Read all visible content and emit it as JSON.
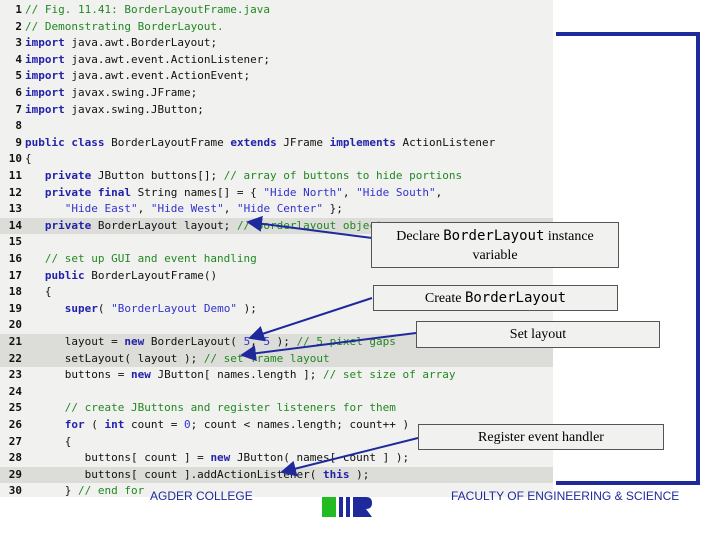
{
  "code_lines": [
    {
      "num": "1",
      "parts": [
        [
          "c",
          "// Fig. 11.41: BorderLayoutFrame.java"
        ]
      ]
    },
    {
      "num": "2",
      "parts": [
        [
          "c",
          "// Demonstrating BorderLayout."
        ]
      ]
    },
    {
      "num": "3",
      "parts": [
        [
          "k",
          "import"
        ],
        [
          "t",
          " java.awt.BorderLayout;"
        ]
      ]
    },
    {
      "num": "4",
      "parts": [
        [
          "k",
          "import"
        ],
        [
          "t",
          " java.awt.event.ActionListener;"
        ]
      ]
    },
    {
      "num": "5",
      "parts": [
        [
          "k",
          "import"
        ],
        [
          "t",
          " java.awt.event.ActionEvent;"
        ]
      ]
    },
    {
      "num": "6",
      "parts": [
        [
          "k",
          "import"
        ],
        [
          "t",
          " javax.swing.JFrame;"
        ]
      ]
    },
    {
      "num": "7",
      "parts": [
        [
          "k",
          "import"
        ],
        [
          "t",
          " javax.swing.JButton;"
        ]
      ]
    },
    {
      "num": "8",
      "parts": []
    },
    {
      "num": "9",
      "parts": [
        [
          "k",
          "public class"
        ],
        [
          "t",
          " BorderLayoutFrame "
        ],
        [
          "k",
          "extends"
        ],
        [
          "t",
          " JFrame "
        ],
        [
          "k",
          "implements"
        ],
        [
          "t",
          " ActionListener"
        ]
      ]
    },
    {
      "num": "10",
      "parts": [
        [
          "t",
          "{"
        ]
      ]
    },
    {
      "num": "11",
      "parts": [
        [
          "k",
          "   private"
        ],
        [
          "t",
          " JButton buttons[]; "
        ],
        [
          "c",
          "// array of buttons to hide portions"
        ]
      ]
    },
    {
      "num": "12",
      "parts": [
        [
          "k",
          "   private final"
        ],
        [
          "t",
          " String names[] = { "
        ],
        [
          "s",
          "\"Hide North\""
        ],
        [
          "t",
          ", "
        ],
        [
          "s",
          "\"Hide South\""
        ],
        [
          "t",
          ","
        ]
      ]
    },
    {
      "num": "13",
      "parts": [
        [
          "s",
          "      \"Hide East\""
        ],
        [
          "t",
          ", "
        ],
        [
          "s",
          "\"Hide West\""
        ],
        [
          "t",
          ", "
        ],
        [
          "s",
          "\"Hide Center\""
        ],
        [
          "t",
          " };"
        ]
      ]
    },
    {
      "num": "14",
      "parts": [
        [
          "k",
          "   private"
        ],
        [
          "t",
          " BorderLayout layout; "
        ],
        [
          "c",
          "// borderlayout object"
        ]
      ],
      "highlight": true
    },
    {
      "num": "15",
      "parts": []
    },
    {
      "num": "16",
      "parts": [
        [
          "c",
          "   // set up GUI and event handling"
        ]
      ]
    },
    {
      "num": "17",
      "parts": [
        [
          "k",
          "   public"
        ],
        [
          "t",
          " BorderLayoutFrame()"
        ]
      ]
    },
    {
      "num": "18",
      "parts": [
        [
          "t",
          "   {"
        ]
      ]
    },
    {
      "num": "19",
      "parts": [
        [
          "k",
          "      super"
        ],
        [
          "t",
          "( "
        ],
        [
          "s",
          "\"BorderLayout Demo\""
        ],
        [
          "t",
          " );"
        ]
      ]
    },
    {
      "num": "20",
      "parts": []
    },
    {
      "num": "21",
      "parts": [
        [
          "t",
          "      layout = "
        ],
        [
          "k",
          "new"
        ],
        [
          "t",
          " BorderLayout( "
        ],
        [
          "s",
          "5"
        ],
        [
          "t",
          ", "
        ],
        [
          "s",
          "5"
        ],
        [
          "t",
          " ); "
        ],
        [
          "c",
          "// 5 pixel gaps"
        ]
      ],
      "highlight": true
    },
    {
      "num": "22",
      "parts": [
        [
          "t",
          "      setLayout( layout ); "
        ],
        [
          "c",
          "// set frame layout"
        ]
      ],
      "highlight": true
    },
    {
      "num": "23",
      "parts": [
        [
          "t",
          "      buttons = "
        ],
        [
          "k",
          "new"
        ],
        [
          "t",
          " JButton[ names.length ]; "
        ],
        [
          "c",
          "// set size of array"
        ]
      ]
    },
    {
      "num": "24",
      "parts": []
    },
    {
      "num": "25",
      "parts": [
        [
          "c",
          "      // create JButtons and register listeners for them"
        ]
      ]
    },
    {
      "num": "26",
      "parts": [
        [
          "k",
          "      for"
        ],
        [
          "t",
          " ( "
        ],
        [
          "k",
          "int"
        ],
        [
          "t",
          " count = "
        ],
        [
          "s",
          "0"
        ],
        [
          "t",
          "; count < names.length; count++ )"
        ]
      ]
    },
    {
      "num": "27",
      "parts": [
        [
          "t",
          "      {"
        ]
      ]
    },
    {
      "num": "28",
      "parts": [
        [
          "t",
          "         buttons[ count ] = "
        ],
        [
          "k",
          "new"
        ],
        [
          "t",
          " JButton( names[ count ] );"
        ]
      ]
    },
    {
      "num": "29",
      "parts": [
        [
          "t",
          "         buttons[ count ].addActionListener( "
        ],
        [
          "k",
          "this"
        ],
        [
          "t",
          " );"
        ]
      ],
      "highlight": true
    },
    {
      "num": "30",
      "parts": [
        [
          "t",
          "      } "
        ],
        [
          "c",
          "// end for"
        ]
      ]
    }
  ],
  "callouts": {
    "declare_pre": "Declare ",
    "declare_mono": "BorderLayout",
    "declare_post": " instance",
    "declare_line2": "variable",
    "create_pre": "Create ",
    "create_mono": "BorderLayout",
    "set_layout": "Set layout",
    "register": "Register event handler"
  },
  "footer": {
    "left": "AGDER COLLEGE",
    "right": "FACULTY OF ENGINEERING & SCIENCE"
  },
  "colors": {
    "frame": "#1e2a9c",
    "logo_green": "#22bb22",
    "logo_blue": "#1e2a9c"
  }
}
